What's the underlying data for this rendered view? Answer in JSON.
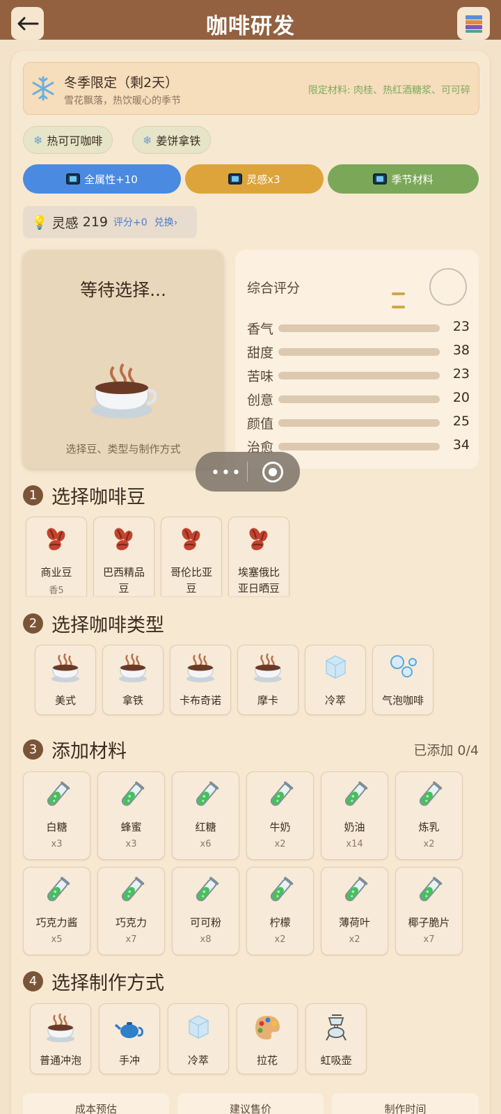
{
  "header": {
    "title": "咖啡研发",
    "back_icon": "back-arrow-icon",
    "book_icon": "books-icon"
  },
  "season": {
    "title": "冬季限定（剩2天）",
    "subtitle": "雪花飘落，热饮暖心的季节",
    "materials": "限定材料: 肉桂、热红酒糖浆、可可碎",
    "icon": "snowflake-icon"
  },
  "season_chips": [
    "热可可咖啡",
    "姜饼拿铁"
  ],
  "ad_buttons": [
    {
      "label": "全属性+10",
      "color": "#4a8ae0"
    },
    {
      "label": "灵感x3",
      "color": "#dca43b"
    },
    {
      "label": "季节材料",
      "color": "#7aa858"
    }
  ],
  "inspiration": {
    "label": "灵感",
    "value": "219",
    "score": "评分+0",
    "exchange": "兑换›"
  },
  "preview": {
    "title": "等待选择...",
    "hint": "选择豆、类型与制作方式"
  },
  "scores": {
    "overall_label": "综合评分",
    "attributes": [
      {
        "name": "香气",
        "value": "23"
      },
      {
        "name": "甜度",
        "value": "38"
      },
      {
        "name": "苦味",
        "value": "23"
      },
      {
        "name": "创意",
        "value": "20"
      },
      {
        "name": "颜值",
        "value": "25"
      },
      {
        "name": "治愈",
        "value": "34"
      }
    ]
  },
  "sections": {
    "beans": {
      "num": "1",
      "title": "选择咖啡豆"
    },
    "types": {
      "num": "2",
      "title": "选择咖啡类型"
    },
    "materials": {
      "num": "3",
      "title": "添加材料",
      "added": "已添加 0/4"
    },
    "methods": {
      "num": "4",
      "title": "选择制作方式"
    }
  },
  "beans": [
    {
      "label": "商业豆",
      "sub": "香5"
    },
    {
      "label": "巴西精品豆",
      "sub": ""
    },
    {
      "label": "哥伦比亚豆",
      "sub": ""
    },
    {
      "label": "埃塞俄比亚日晒豆",
      "sub": ""
    }
  ],
  "types": [
    {
      "label": "美式",
      "icon": "coffee-cup-icon"
    },
    {
      "label": "拿铁",
      "icon": "coffee-cup-icon"
    },
    {
      "label": "卡布奇诺",
      "icon": "coffee-cup-icon"
    },
    {
      "label": "摩卡",
      "icon": "coffee-cup-icon"
    },
    {
      "label": "冷萃",
      "icon": "ice-cube-icon"
    },
    {
      "label": "气泡咖啡",
      "icon": "bubbles-icon"
    }
  ],
  "materials": [
    {
      "label": "白糖",
      "count": "x3"
    },
    {
      "label": "蜂蜜",
      "count": "x3"
    },
    {
      "label": "红糖",
      "count": "x6"
    },
    {
      "label": "牛奶",
      "count": "x2"
    },
    {
      "label": "奶油",
      "count": "x14"
    },
    {
      "label": "炼乳",
      "count": "x2"
    },
    {
      "label": "巧克力酱",
      "count": "x5"
    },
    {
      "label": "巧克力",
      "count": "x7"
    },
    {
      "label": "可可粉",
      "count": "x8"
    },
    {
      "label": "柠檬",
      "count": "x2"
    },
    {
      "label": "薄荷叶",
      "count": "x2"
    },
    {
      "label": "椰子脆片",
      "count": "x7"
    }
  ],
  "methods": [
    {
      "label": "普通冲泡",
      "icon": "coffee-cup-icon"
    },
    {
      "label": "手冲",
      "icon": "teapot-icon"
    },
    {
      "label": "冷萃",
      "icon": "ice-cube-icon"
    },
    {
      "label": "拉花",
      "icon": "palette-icon"
    },
    {
      "label": "虹吸壶",
      "icon": "siphon-icon"
    }
  ],
  "bottom_tabs": [
    "成本预估",
    "建议售价",
    "制作时间"
  ]
}
